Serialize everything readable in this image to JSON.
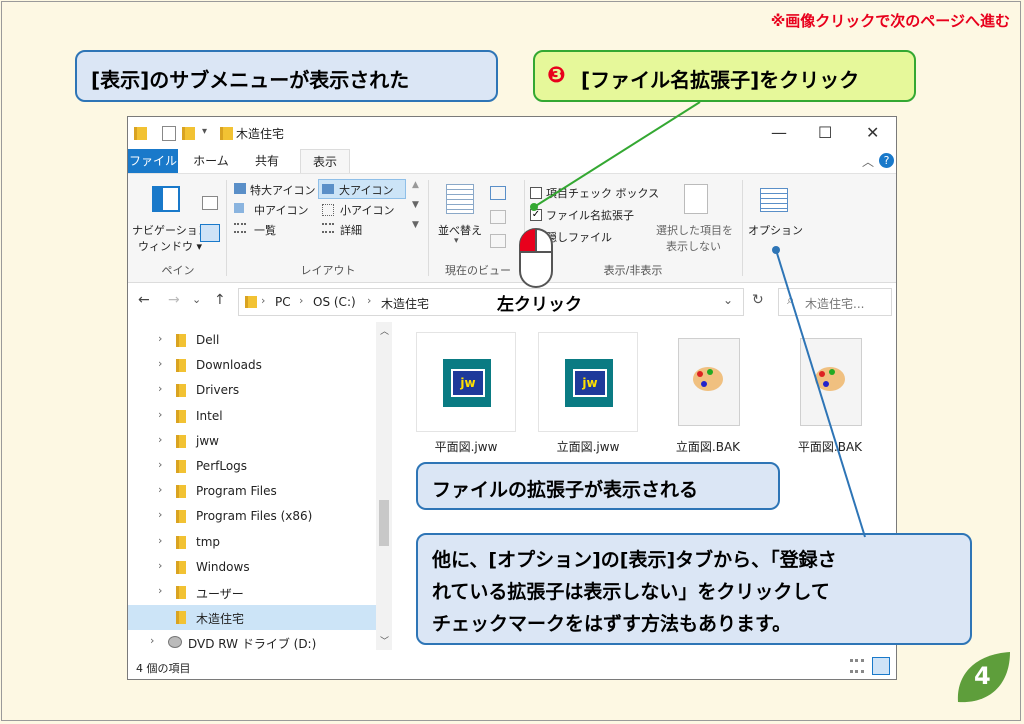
{
  "nav_note": "※画像クリックで次のページへ進む",
  "callouts": {
    "submenu": "[表示]のサブメニューが表示された",
    "step_num": "❸",
    "step": "[ファイル名拡張子]をクリック",
    "ext_shown": "ファイルの拡張子が表示される",
    "other_line1": "他に、[オプション]の[表示]タブから、「登録さ",
    "other_line2": "れている拡張子は表示しない」をクリックして",
    "other_line3": "チェックマークをはずす方法もあります。",
    "left_click": "左クリック"
  },
  "window": {
    "title": "木造住宅",
    "tabs": [
      "ファイル",
      "ホーム",
      "共有",
      "表示"
    ],
    "ribbon": {
      "nav_pane_1": "ナビゲーション",
      "nav_pane_2": "ウィンドウ ▾",
      "pane_group": "ペイン",
      "layout": [
        "特大アイコン",
        "大アイコン",
        "中アイコン",
        "小アイコン",
        "一覧",
        "詳細"
      ],
      "layout_group": "レイアウト",
      "sort_1": "並べ替え",
      "current_view_group": "現在のビュー",
      "item_checkbox": "項目チェック ボックス",
      "file_ext": "ファイル名拡張子",
      "hidden_files": "隠しファイル",
      "hide_selected_1": "選択した項目を",
      "hide_selected_2": "表示しない",
      "show_hide_group": "表示/非表示",
      "options": "オプション"
    },
    "address": {
      "pc": "PC",
      "drive": "OS (C:)",
      "folder": "木造住宅",
      "search_placeholder": "木造住宅..."
    },
    "nav_items": [
      "Dell",
      "Downloads",
      "Drivers",
      "Intel",
      "jww",
      "PerfLogs",
      "Program Files",
      "Program Files (x86)",
      "tmp",
      "Windows",
      "ユーザー",
      "木造住宅",
      "DVD RW ドライブ (D:)"
    ],
    "files": [
      "平面図.jww",
      "立面図.jww",
      "立面図.BAK",
      "平面図.BAK"
    ],
    "status": "4 個の項目"
  },
  "page_number": "4",
  "colors": {
    "red": "#e8001c",
    "blue": "#2e75b6",
    "green": "#34a832",
    "win_blue": "#1979ca"
  }
}
